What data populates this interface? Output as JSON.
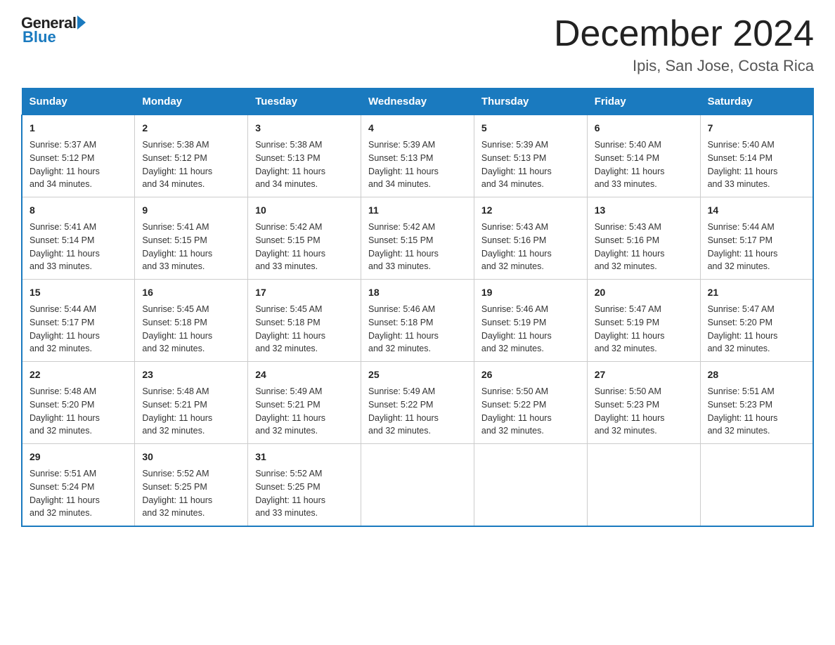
{
  "header": {
    "logo_general": "General",
    "logo_blue": "Blue",
    "month_title": "December 2024",
    "location": "Ipis, San Jose, Costa Rica"
  },
  "days_of_week": [
    "Sunday",
    "Monday",
    "Tuesday",
    "Wednesday",
    "Thursday",
    "Friday",
    "Saturday"
  ],
  "weeks": [
    [
      {
        "day": "1",
        "sunrise": "5:37 AM",
        "sunset": "5:12 PM",
        "daylight": "11 hours and 34 minutes."
      },
      {
        "day": "2",
        "sunrise": "5:38 AM",
        "sunset": "5:12 PM",
        "daylight": "11 hours and 34 minutes."
      },
      {
        "day": "3",
        "sunrise": "5:38 AM",
        "sunset": "5:13 PM",
        "daylight": "11 hours and 34 minutes."
      },
      {
        "day": "4",
        "sunrise": "5:39 AM",
        "sunset": "5:13 PM",
        "daylight": "11 hours and 34 minutes."
      },
      {
        "day": "5",
        "sunrise": "5:39 AM",
        "sunset": "5:13 PM",
        "daylight": "11 hours and 34 minutes."
      },
      {
        "day": "6",
        "sunrise": "5:40 AM",
        "sunset": "5:14 PM",
        "daylight": "11 hours and 33 minutes."
      },
      {
        "day": "7",
        "sunrise": "5:40 AM",
        "sunset": "5:14 PM",
        "daylight": "11 hours and 33 minutes."
      }
    ],
    [
      {
        "day": "8",
        "sunrise": "5:41 AM",
        "sunset": "5:14 PM",
        "daylight": "11 hours and 33 minutes."
      },
      {
        "day": "9",
        "sunrise": "5:41 AM",
        "sunset": "5:15 PM",
        "daylight": "11 hours and 33 minutes."
      },
      {
        "day": "10",
        "sunrise": "5:42 AM",
        "sunset": "5:15 PM",
        "daylight": "11 hours and 33 minutes."
      },
      {
        "day": "11",
        "sunrise": "5:42 AM",
        "sunset": "5:15 PM",
        "daylight": "11 hours and 33 minutes."
      },
      {
        "day": "12",
        "sunrise": "5:43 AM",
        "sunset": "5:16 PM",
        "daylight": "11 hours and 32 minutes."
      },
      {
        "day": "13",
        "sunrise": "5:43 AM",
        "sunset": "5:16 PM",
        "daylight": "11 hours and 32 minutes."
      },
      {
        "day": "14",
        "sunrise": "5:44 AM",
        "sunset": "5:17 PM",
        "daylight": "11 hours and 32 minutes."
      }
    ],
    [
      {
        "day": "15",
        "sunrise": "5:44 AM",
        "sunset": "5:17 PM",
        "daylight": "11 hours and 32 minutes."
      },
      {
        "day": "16",
        "sunrise": "5:45 AM",
        "sunset": "5:18 PM",
        "daylight": "11 hours and 32 minutes."
      },
      {
        "day": "17",
        "sunrise": "5:45 AM",
        "sunset": "5:18 PM",
        "daylight": "11 hours and 32 minutes."
      },
      {
        "day": "18",
        "sunrise": "5:46 AM",
        "sunset": "5:18 PM",
        "daylight": "11 hours and 32 minutes."
      },
      {
        "day": "19",
        "sunrise": "5:46 AM",
        "sunset": "5:19 PM",
        "daylight": "11 hours and 32 minutes."
      },
      {
        "day": "20",
        "sunrise": "5:47 AM",
        "sunset": "5:19 PM",
        "daylight": "11 hours and 32 minutes."
      },
      {
        "day": "21",
        "sunrise": "5:47 AM",
        "sunset": "5:20 PM",
        "daylight": "11 hours and 32 minutes."
      }
    ],
    [
      {
        "day": "22",
        "sunrise": "5:48 AM",
        "sunset": "5:20 PM",
        "daylight": "11 hours and 32 minutes."
      },
      {
        "day": "23",
        "sunrise": "5:48 AM",
        "sunset": "5:21 PM",
        "daylight": "11 hours and 32 minutes."
      },
      {
        "day": "24",
        "sunrise": "5:49 AM",
        "sunset": "5:21 PM",
        "daylight": "11 hours and 32 minutes."
      },
      {
        "day": "25",
        "sunrise": "5:49 AM",
        "sunset": "5:22 PM",
        "daylight": "11 hours and 32 minutes."
      },
      {
        "day": "26",
        "sunrise": "5:50 AM",
        "sunset": "5:22 PM",
        "daylight": "11 hours and 32 minutes."
      },
      {
        "day": "27",
        "sunrise": "5:50 AM",
        "sunset": "5:23 PM",
        "daylight": "11 hours and 32 minutes."
      },
      {
        "day": "28",
        "sunrise": "5:51 AM",
        "sunset": "5:23 PM",
        "daylight": "11 hours and 32 minutes."
      }
    ],
    [
      {
        "day": "29",
        "sunrise": "5:51 AM",
        "sunset": "5:24 PM",
        "daylight": "11 hours and 32 minutes."
      },
      {
        "day": "30",
        "sunrise": "5:52 AM",
        "sunset": "5:25 PM",
        "daylight": "11 hours and 32 minutes."
      },
      {
        "day": "31",
        "sunrise": "5:52 AM",
        "sunset": "5:25 PM",
        "daylight": "11 hours and 33 minutes."
      },
      null,
      null,
      null,
      null
    ]
  ],
  "labels": {
    "sunrise": "Sunrise:",
    "sunset": "Sunset:",
    "daylight": "Daylight:"
  }
}
